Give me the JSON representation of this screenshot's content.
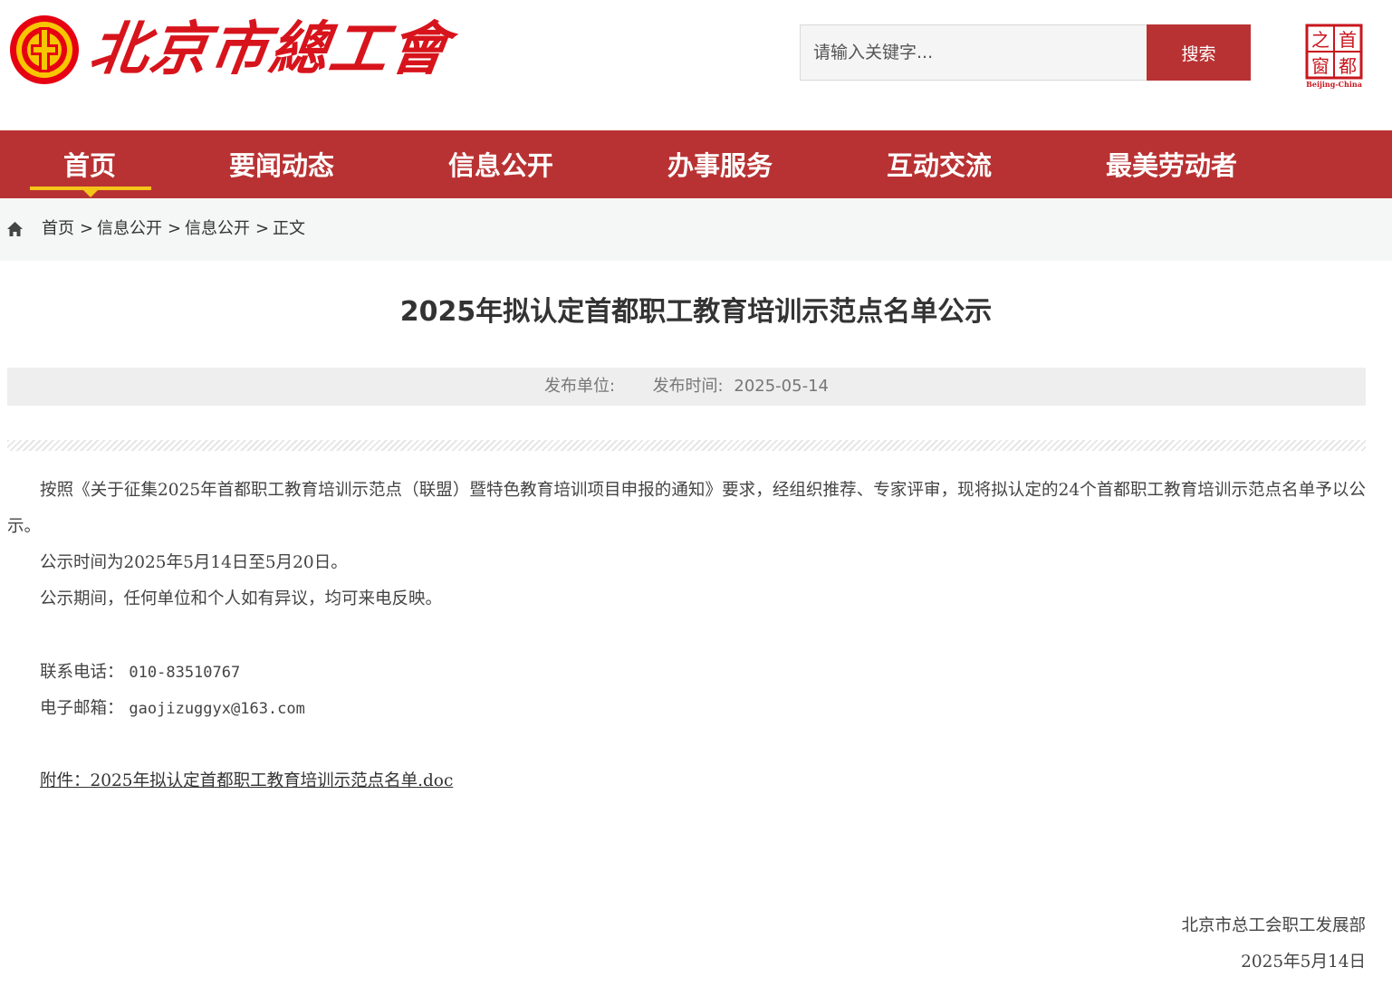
{
  "header": {
    "logo_text": "北京市總工會",
    "search": {
      "placeholder": "请输入关键字...",
      "button_label": "搜索"
    },
    "capital_logo": {
      "chars": [
        "之",
        "首",
        "窗",
        "都"
      ],
      "caption": "Beijing-China"
    }
  },
  "nav": {
    "items": [
      {
        "label": "首页",
        "active": true
      },
      {
        "label": "要闻动态"
      },
      {
        "label": "信息公开"
      },
      {
        "label": "办事服务"
      },
      {
        "label": "互动交流"
      },
      {
        "label": "最美劳动者"
      }
    ]
  },
  "breadcrumb": {
    "icon": "home-icon",
    "items": [
      "首页",
      "信息公开",
      "信息公开",
      "正文"
    ],
    "separator": ">"
  },
  "article": {
    "title": "2025年拟认定首都职工教育培训示范点名单公示",
    "meta": {
      "unit_label": "发布单位:",
      "unit_value": "",
      "time_label": "发布时间:",
      "time_value": "2025-05-14"
    },
    "paragraphs": [
      "按照《关于征集2025年首都职工教育培训示范点（联盟）暨特色教育培训项目申报的通知》要求，经组织推荐、专家评审，现将拟认定的24个首都职工教育培训示范点名单予以公示。",
      "公示时间为2025年5月14日至5月20日。",
      "公示期间，任何单位和个人如有异议，均可来电反映。"
    ],
    "contact": {
      "phone_label": "联系电话：",
      "phone": "010-83510767",
      "email_label": "电子邮箱：",
      "email": "gaojizuggyx@163.com"
    },
    "attachment": "附件：2025年拟认定首都职工教育培训示范点名单.doc",
    "signature": {
      "org": "北京市总工会职工发展部",
      "date": "2025年5月14日"
    }
  },
  "colors": {
    "brand_red": "#b93233",
    "logo_red": "#d7141c",
    "nav_underline": "#f5c518"
  }
}
